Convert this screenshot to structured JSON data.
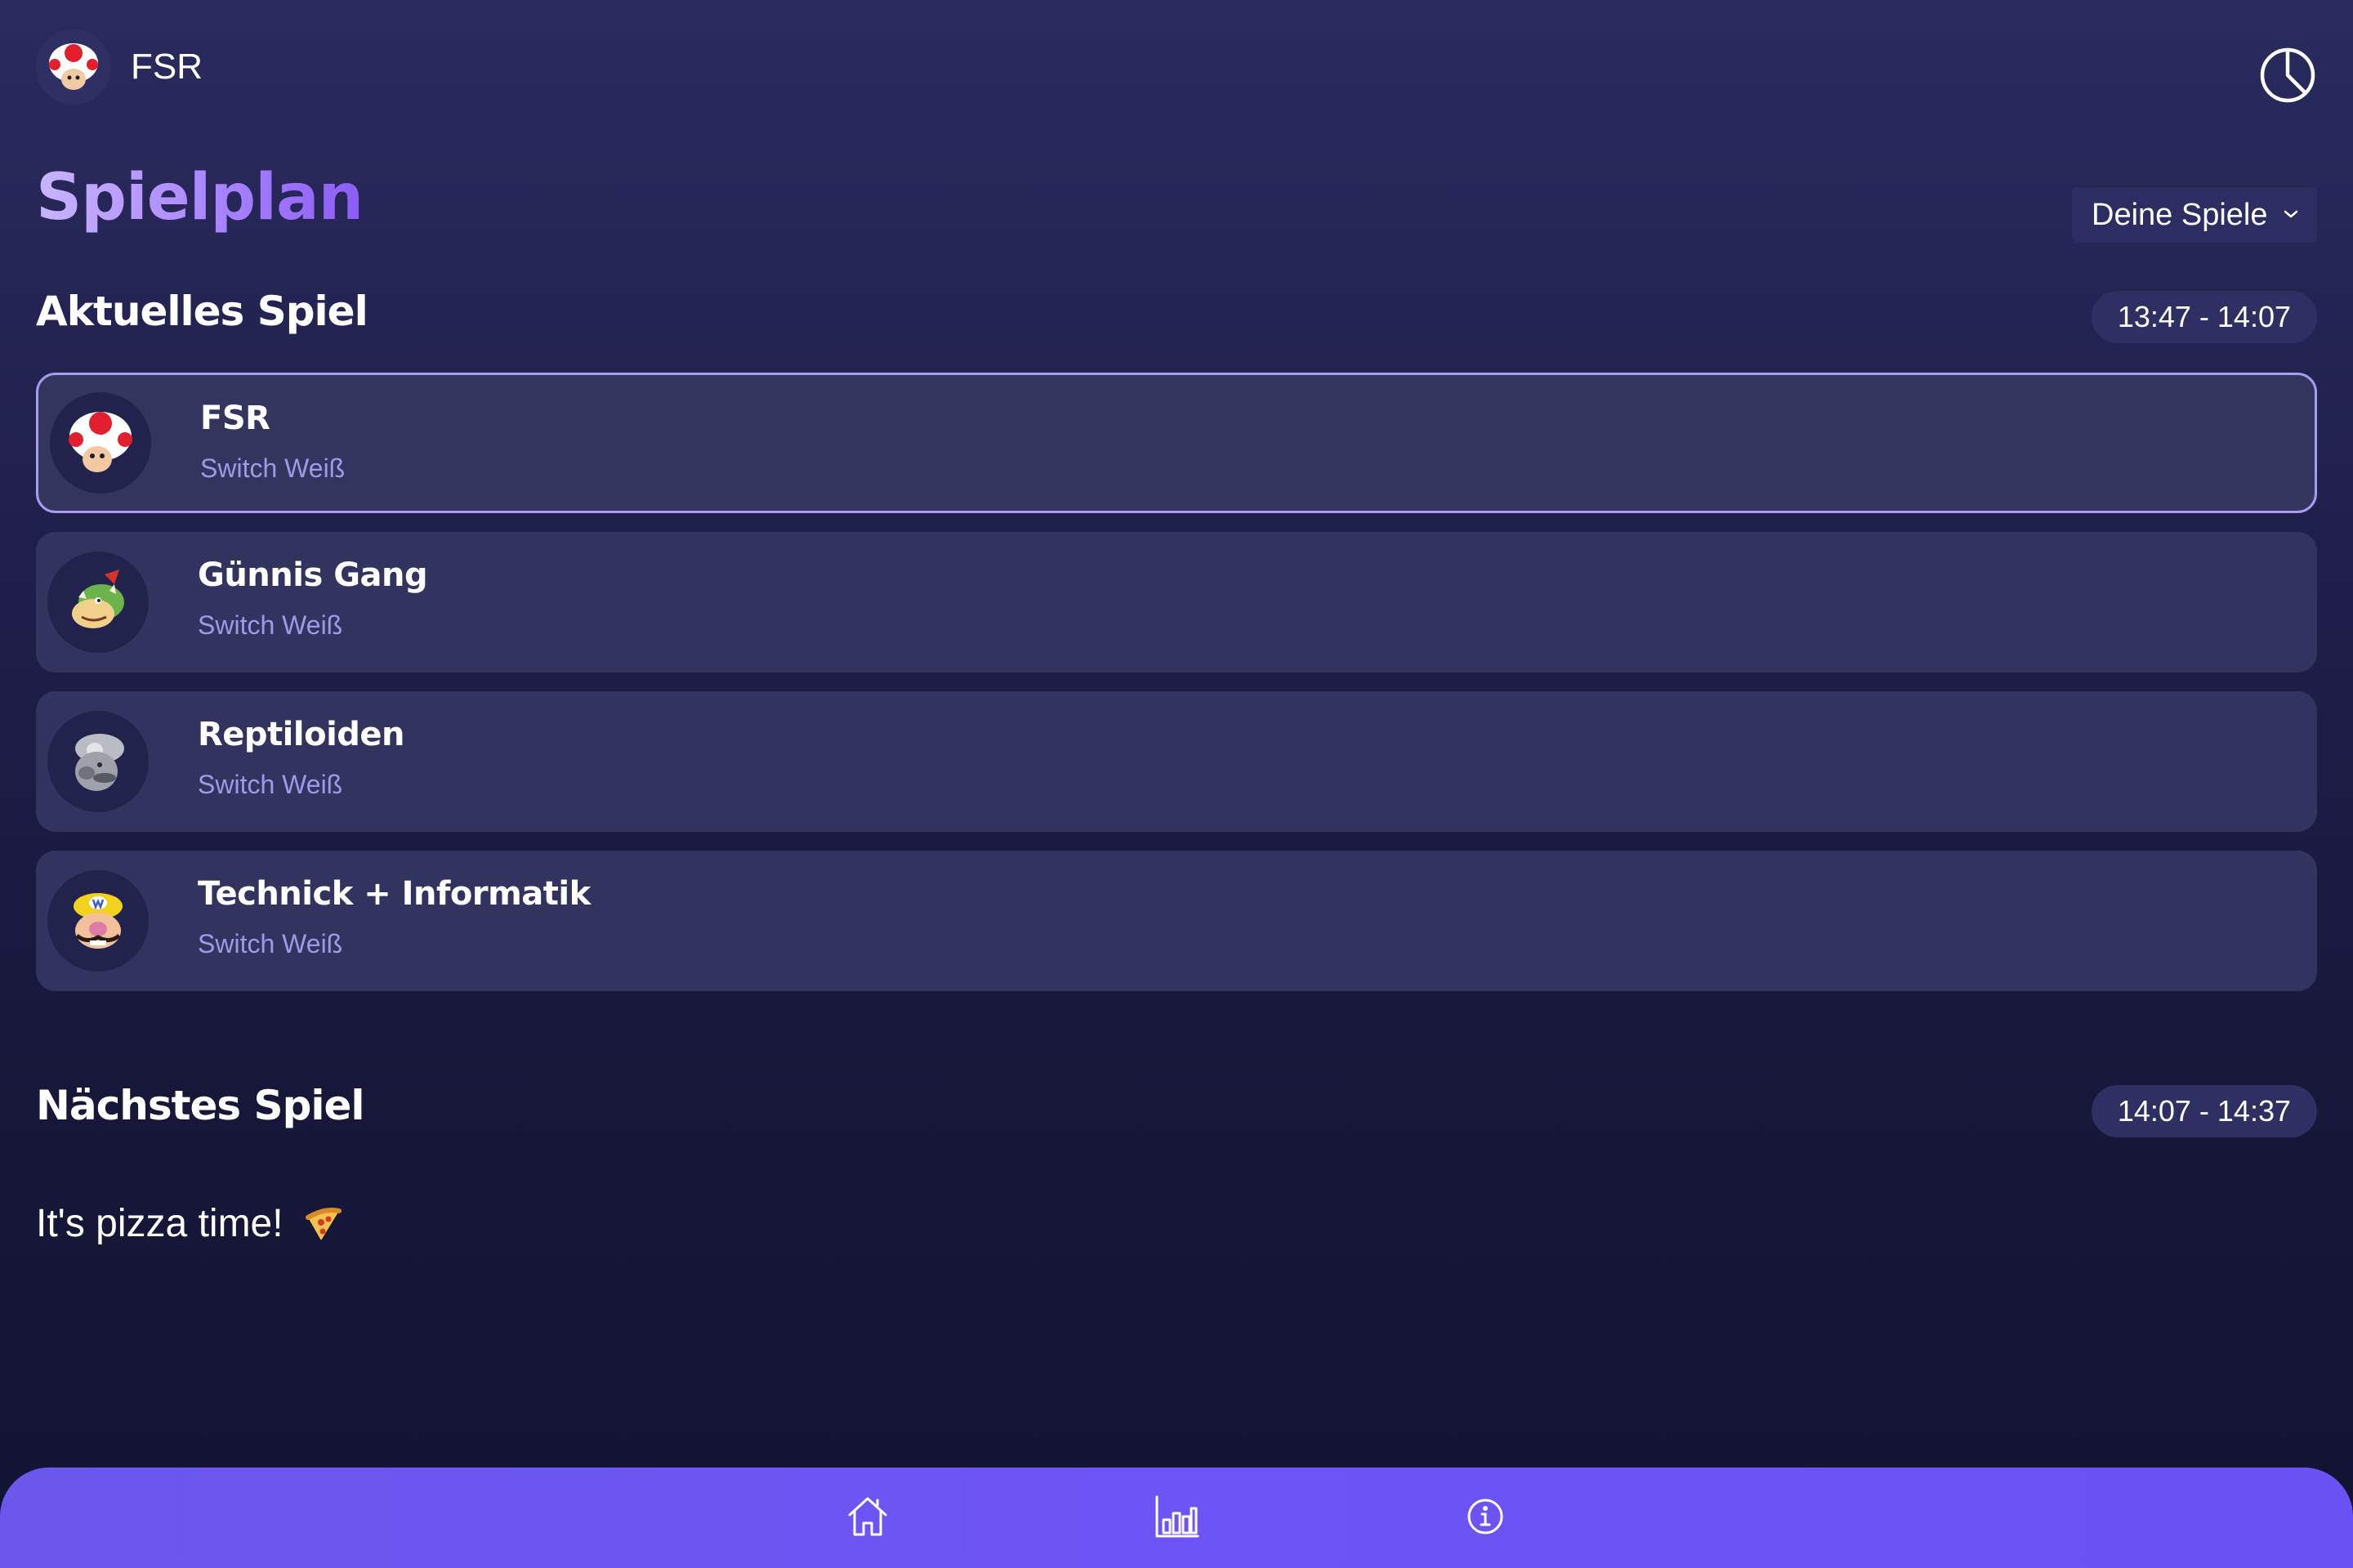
{
  "header": {
    "title": "FSR",
    "avatar_icon": "toad-mushroom-icon",
    "stats_icon": "pie-chart-icon"
  },
  "page": {
    "title": "Spielplan"
  },
  "filter": {
    "selected": "Deine Spiele",
    "icon": "chevron-down-icon"
  },
  "current_game": {
    "heading": "Aktuelles Spiel",
    "time": "13:47 - 14:07",
    "teams": [
      {
        "name": "FSR",
        "device": "Switch Weiß",
        "icon": "toad-icon",
        "active": true
      },
      {
        "name": "Günnis Gang",
        "device": "Switch Weiß",
        "icon": "bowser-jr-icon",
        "active": false
      },
      {
        "name": "Reptiloiden",
        "device": "Switch Weiß",
        "icon": "metal-mario-icon",
        "active": false
      },
      {
        "name": "Technick + Informatik",
        "device": "Switch Weiß",
        "icon": "wario-icon",
        "active": false
      }
    ]
  },
  "next_game": {
    "heading": "Nächstes Spiel",
    "time": "14:07 - 14:37",
    "message": "It's pizza time!",
    "message_icon": "pizza-icon"
  },
  "bottom_nav": {
    "items": [
      {
        "name": "home",
        "icon": "home-icon"
      },
      {
        "name": "stats",
        "icon": "bar-chart-icon"
      },
      {
        "name": "info",
        "icon": "info-icon"
      }
    ]
  },
  "colors": {
    "accent": "#6c55f0",
    "title_gradient_start": "#c8b5ff",
    "title_gradient_end": "#8c5cf6",
    "card_bg": "#32335f",
    "active_border": "#a99cf0",
    "subtext": "#9d9ae8"
  }
}
